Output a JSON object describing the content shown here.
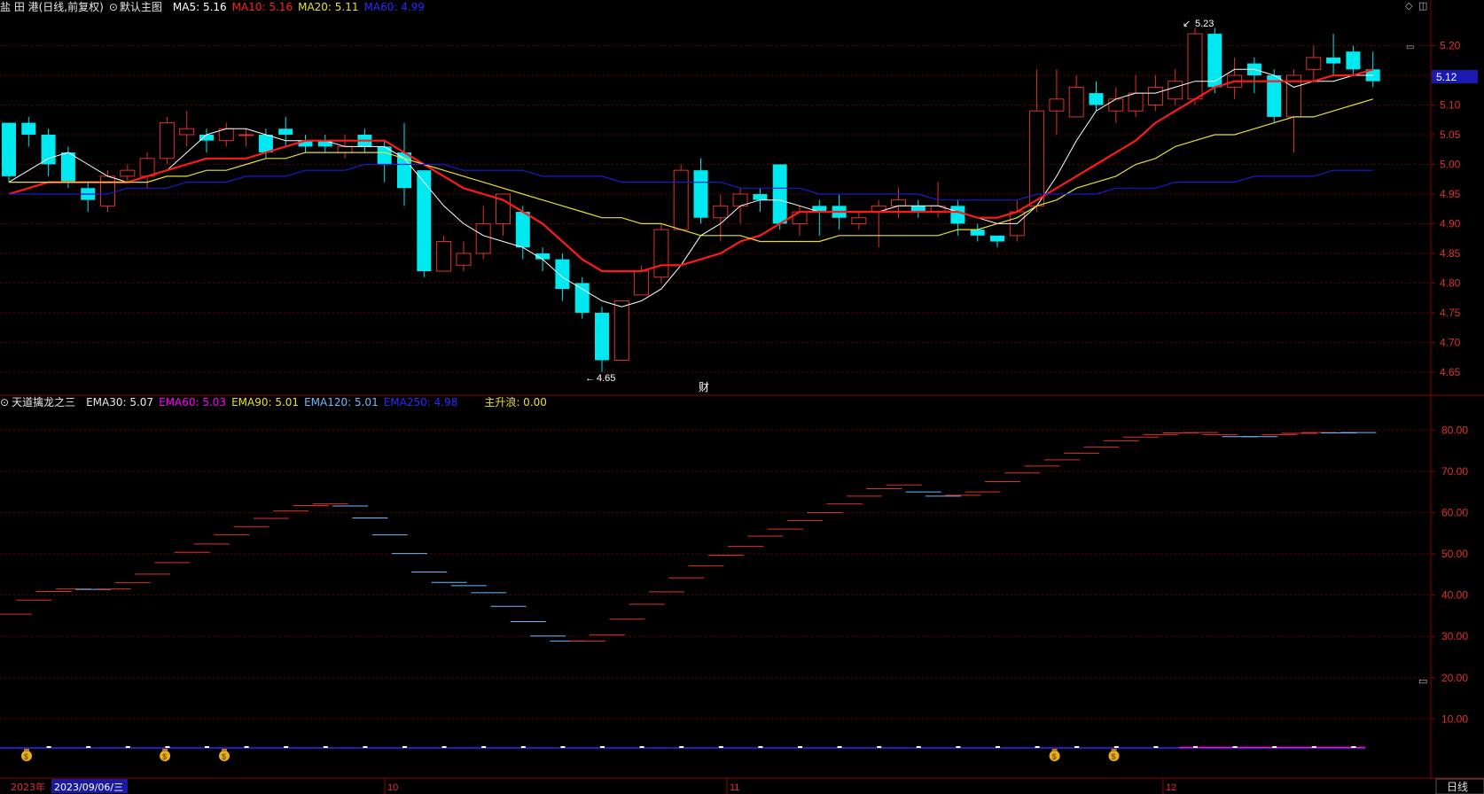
{
  "header": {
    "stock_title": "盐 田 港(日线,前复权)",
    "main_chart_label": "默认主图",
    "ma5": "MA5: 5.16",
    "ma10": "MA10: 5.16",
    "ma20": "MA20: 5.11",
    "ma60": "MA60: 4.99"
  },
  "indicator_header": {
    "name": "天道擒龙之三",
    "ema30": "EMA30: 5.07",
    "ema60": "EMA60: 5.03",
    "ema90": "EMA90: 5.01",
    "ema120": "EMA120: 5.01",
    "ema250": "EMA250: 4.98",
    "main_wave": "主升浪: 0.00"
  },
  "footer": {
    "year_label": "2023年",
    "date_label": "2023/09/06/三",
    "month_labels": [
      "10",
      "11",
      "12"
    ],
    "period_button": "日线"
  },
  "annotations": {
    "high_label": "5.23",
    "low_label": "4.65",
    "fin_marker": "财",
    "current_price": "5.12"
  },
  "colors": {
    "up": "#e0302a",
    "down": "#00e8f0",
    "ma5": "#ffffff",
    "ma10": "#ff1a1a",
    "ma20": "#e8e030",
    "ma60": "#1a1ad0",
    "ema60": "#ff00ff",
    "ema90": "#e8e030",
    "ema120": "#6fb9ff",
    "ema250": "#1a1ad0",
    "grid": "#6a0000",
    "axis_text": "#e03030"
  },
  "chart_data": [
    {
      "type": "candlestick",
      "title": "",
      "ylim": [
        4.62,
        5.25
      ],
      "y_ticks": [
        4.65,
        4.7,
        4.75,
        4.8,
        4.85,
        4.9,
        4.95,
        5.0,
        5.05,
        5.1,
        5.15,
        5.2
      ],
      "candles": [
        [
          5.07,
          4.98,
          5.07,
          4.97
        ],
        [
          5.07,
          5.05,
          5.08,
          5.03
        ],
        [
          5.05,
          5.0,
          5.06,
          4.98
        ],
        [
          5.02,
          4.97,
          5.03,
          4.96
        ],
        [
          4.96,
          4.94,
          4.97,
          4.92
        ],
        [
          4.93,
          4.98,
          4.99,
          4.92
        ],
        [
          4.98,
          4.99,
          5.0,
          4.97
        ],
        [
          4.98,
          5.01,
          5.02,
          4.96
        ],
        [
          5.01,
          5.07,
          5.08,
          5.0
        ],
        [
          5.05,
          5.06,
          5.09,
          5.03
        ],
        [
          5.05,
          5.04,
          5.06,
          5.02
        ],
        [
          5.04,
          5.06,
          5.07,
          5.03
        ],
        [
          5.05,
          5.05,
          5.06,
          5.03
        ],
        [
          5.05,
          5.02,
          5.06,
          5.01
        ],
        [
          5.06,
          5.05,
          5.08,
          5.03
        ],
        [
          5.04,
          5.03,
          5.05,
          5.02
        ],
        [
          5.04,
          5.03,
          5.05,
          5.02
        ],
        [
          5.02,
          5.03,
          5.05,
          5.01
        ],
        [
          5.05,
          5.03,
          5.06,
          5.02
        ],
        [
          5.03,
          5.0,
          5.04,
          4.97
        ],
        [
          5.02,
          4.96,
          5.07,
          4.93
        ],
        [
          4.99,
          4.82,
          4.99,
          4.81
        ],
        [
          4.82,
          4.87,
          4.88,
          4.82
        ],
        [
          4.83,
          4.85,
          4.87,
          4.82
        ],
        [
          4.85,
          4.9,
          4.93,
          4.84
        ],
        [
          4.9,
          4.95,
          4.95,
          4.88
        ],
        [
          4.92,
          4.86,
          4.93,
          4.84
        ],
        [
          4.85,
          4.84,
          4.86,
          4.82
        ],
        [
          4.84,
          4.79,
          4.85,
          4.77
        ],
        [
          4.8,
          4.75,
          4.81,
          4.74
        ],
        [
          4.75,
          4.67,
          4.76,
          4.65
        ],
        [
          4.67,
          4.77,
          4.77,
          4.67
        ],
        [
          4.78,
          4.82,
          4.83,
          4.78
        ],
        [
          4.81,
          4.89,
          4.9,
          4.8
        ],
        [
          4.89,
          4.99,
          5.0,
          4.89
        ],
        [
          4.99,
          4.91,
          5.01,
          4.9
        ],
        [
          4.91,
          4.93,
          4.95,
          4.87
        ],
        [
          4.93,
          4.95,
          4.96,
          4.9
        ],
        [
          4.95,
          4.94,
          4.96,
          4.92
        ],
        [
          5.0,
          4.9,
          5.0,
          4.89
        ],
        [
          4.9,
          4.92,
          4.93,
          4.88
        ],
        [
          4.93,
          4.92,
          4.94,
          4.88
        ],
        [
          4.93,
          4.91,
          4.95,
          4.89
        ],
        [
          4.9,
          4.91,
          4.92,
          4.89
        ],
        [
          4.92,
          4.93,
          4.94,
          4.86
        ],
        [
          4.93,
          4.94,
          4.96,
          4.91
        ],
        [
          4.93,
          4.92,
          4.94,
          4.91
        ],
        [
          4.92,
          4.93,
          4.97,
          4.91
        ],
        [
          4.93,
          4.9,
          4.94,
          4.88
        ],
        [
          4.89,
          4.88,
          4.9,
          4.87
        ],
        [
          4.88,
          4.87,
          4.88,
          4.86
        ],
        [
          4.88,
          4.92,
          4.94,
          4.87
        ],
        [
          4.93,
          5.09,
          5.16,
          4.92
        ],
        [
          5.09,
          5.11,
          5.16,
          5.05
        ],
        [
          5.08,
          5.13,
          5.15,
          5.08
        ],
        [
          5.12,
          5.1,
          5.14,
          5.09
        ],
        [
          5.09,
          5.11,
          5.13,
          5.07
        ],
        [
          5.09,
          5.12,
          5.15,
          5.08
        ],
        [
          5.1,
          5.13,
          5.15,
          5.09
        ],
        [
          5.11,
          5.14,
          5.16,
          5.1
        ],
        [
          5.11,
          5.22,
          5.23,
          5.1
        ],
        [
          5.22,
          5.13,
          5.23,
          5.12
        ],
        [
          5.13,
          5.15,
          5.18,
          5.11
        ],
        [
          5.17,
          5.15,
          5.18,
          5.12
        ],
        [
          5.15,
          5.08,
          5.16,
          5.07
        ],
        [
          5.08,
          5.15,
          5.16,
          5.02
        ],
        [
          5.16,
          5.18,
          5.2,
          5.14
        ],
        [
          5.18,
          5.17,
          5.22,
          5.15
        ],
        [
          5.19,
          5.16,
          5.2,
          5.15
        ],
        [
          5.16,
          5.14,
          5.19,
          5.13
        ]
      ],
      "ma_series": [
        {
          "name": "MA5",
          "values": [
            4.97,
            4.99,
            5.01,
            5.02,
            5.0,
            4.98,
            4.97,
            4.98,
            4.99,
            5.02,
            5.05,
            5.06,
            5.06,
            5.05,
            5.04,
            5.04,
            5.04,
            5.03,
            5.03,
            5.03,
            5.01,
            4.97,
            4.93,
            4.9,
            4.88,
            4.87,
            4.86,
            4.84,
            4.81,
            4.79,
            4.77,
            4.76,
            4.77,
            4.79,
            4.83,
            4.88,
            4.9,
            4.93,
            4.94,
            4.94,
            4.93,
            4.92,
            4.92,
            4.92,
            4.92,
            4.93,
            4.93,
            4.93,
            4.92,
            4.91,
            4.9,
            4.9,
            4.93,
            4.98,
            5.04,
            5.09,
            5.11,
            5.12,
            5.12,
            5.13,
            5.14,
            5.14,
            5.16,
            5.16,
            5.15,
            5.13,
            5.14,
            5.14,
            5.15,
            5.15
          ]
        },
        {
          "name": "MA10",
          "values": [
            4.95,
            4.96,
            4.97,
            4.97,
            4.97,
            4.97,
            4.97,
            4.98,
            4.99,
            5.0,
            5.01,
            5.01,
            5.01,
            5.02,
            5.03,
            5.04,
            5.04,
            5.04,
            5.04,
            5.04,
            5.02,
            5.0,
            4.98,
            4.96,
            4.95,
            4.94,
            4.92,
            4.9,
            4.87,
            4.84,
            4.82,
            4.82,
            4.82,
            4.83,
            4.83,
            4.84,
            4.85,
            4.87,
            4.88,
            4.9,
            4.92,
            4.92,
            4.92,
            4.92,
            4.92,
            4.92,
            4.92,
            4.92,
            4.92,
            4.91,
            4.91,
            4.92,
            4.94,
            4.96,
            4.98,
            5.0,
            5.02,
            5.04,
            5.07,
            5.09,
            5.11,
            5.13,
            5.14,
            5.14,
            5.14,
            5.14,
            5.14,
            5.15,
            5.15,
            5.16
          ]
        },
        {
          "name": "MA20",
          "values": [
            4.97,
            4.97,
            4.97,
            4.97,
            4.97,
            4.97,
            4.97,
            4.97,
            4.98,
            4.98,
            4.99,
            4.99,
            5.0,
            5.01,
            5.01,
            5.02,
            5.02,
            5.02,
            5.02,
            5.02,
            5.01,
            5.0,
            4.99,
            4.98,
            4.97,
            4.96,
            4.95,
            4.94,
            4.93,
            4.92,
            4.91,
            4.91,
            4.9,
            4.9,
            4.89,
            4.88,
            4.88,
            4.88,
            4.87,
            4.87,
            4.87,
            4.87,
            4.88,
            4.88,
            4.88,
            4.88,
            4.88,
            4.88,
            4.89,
            4.89,
            4.9,
            4.91,
            4.93,
            4.94,
            4.96,
            4.97,
            4.98,
            5.0,
            5.01,
            5.03,
            5.04,
            5.05,
            5.05,
            5.06,
            5.07,
            5.08,
            5.08,
            5.09,
            5.1,
            5.11
          ]
        },
        {
          "name": "MA60",
          "values": [
            4.95,
            4.95,
            4.95,
            4.95,
            4.95,
            4.95,
            4.96,
            4.96,
            4.96,
            4.97,
            4.97,
            4.97,
            4.98,
            4.98,
            4.98,
            4.99,
            4.99,
            4.99,
            5.0,
            5.0,
            5.0,
            5.0,
            5.0,
            4.99,
            4.99,
            4.99,
            4.99,
            4.98,
            4.98,
            4.98,
            4.98,
            4.97,
            4.97,
            4.97,
            4.97,
            4.97,
            4.97,
            4.96,
            4.96,
            4.96,
            4.96,
            4.95,
            4.95,
            4.95,
            4.95,
            4.95,
            4.95,
            4.94,
            4.94,
            4.94,
            4.94,
            4.94,
            4.95,
            4.95,
            4.95,
            4.95,
            4.96,
            4.96,
            4.96,
            4.97,
            4.97,
            4.97,
            4.97,
            4.98,
            4.98,
            4.98,
            4.98,
            4.99,
            4.99,
            4.99
          ]
        }
      ]
    },
    {
      "type": "indicator",
      "title": "",
      "ylim": [
        0,
        85
      ],
      "y_ticks": [
        10,
        20,
        30,
        40,
        50,
        60,
        70,
        80
      ],
      "steps": [
        [
          35.4,
          "up"
        ],
        [
          38.8,
          "up"
        ],
        [
          40.9,
          "up"
        ],
        [
          41.5,
          "up"
        ],
        [
          41.4,
          "down"
        ],
        [
          41.5,
          "up"
        ],
        [
          43.0,
          "up"
        ],
        [
          45.1,
          "up"
        ],
        [
          47.9,
          "up"
        ],
        [
          50.4,
          "up"
        ],
        [
          52.4,
          "up"
        ],
        [
          54.6,
          "up"
        ],
        [
          56.6,
          "up"
        ],
        [
          58.6,
          "up"
        ],
        [
          60.4,
          "up"
        ],
        [
          61.7,
          "up"
        ],
        [
          62.1,
          "up"
        ],
        [
          61.6,
          "down"
        ],
        [
          58.7,
          "down"
        ],
        [
          54.6,
          "down"
        ],
        [
          50.1,
          "down"
        ],
        [
          45.6,
          "down"
        ],
        [
          43.1,
          "down"
        ],
        [
          42.3,
          "down"
        ],
        [
          40.6,
          "down"
        ],
        [
          37.3,
          "down"
        ],
        [
          33.6,
          "down"
        ],
        [
          30.1,
          "down"
        ],
        [
          28.9,
          "down"
        ],
        [
          28.9,
          "up"
        ],
        [
          30.4,
          "up"
        ],
        [
          34.2,
          "up"
        ],
        [
          37.8,
          "up"
        ],
        [
          40.8,
          "up"
        ],
        [
          44.2,
          "up"
        ],
        [
          47.1,
          "up"
        ],
        [
          49.7,
          "up"
        ],
        [
          51.8,
          "up"
        ],
        [
          54.3,
          "up"
        ],
        [
          56.0,
          "up"
        ],
        [
          58.1,
          "up"
        ],
        [
          60.0,
          "up"
        ],
        [
          62.1,
          "up"
        ],
        [
          64.0,
          "up"
        ],
        [
          65.8,
          "up"
        ],
        [
          66.7,
          "up"
        ],
        [
          65.0,
          "down"
        ],
        [
          64.0,
          "down"
        ],
        [
          64.2,
          "up"
        ],
        [
          65.0,
          "up"
        ],
        [
          67.5,
          "up"
        ],
        [
          69.6,
          "up"
        ],
        [
          71.3,
          "up"
        ],
        [
          72.8,
          "up"
        ],
        [
          74.4,
          "up"
        ],
        [
          75.9,
          "up"
        ],
        [
          77.4,
          "up"
        ],
        [
          78.3,
          "up"
        ],
        [
          78.9,
          "up"
        ],
        [
          79.3,
          "up"
        ],
        [
          79.4,
          "up"
        ],
        [
          78.9,
          "up"
        ],
        [
          78.4,
          "down"
        ],
        [
          78.4,
          "down"
        ],
        [
          78.9,
          "up"
        ],
        [
          79.2,
          "up"
        ],
        [
          79.4,
          "up"
        ],
        [
          79.3,
          "down"
        ],
        [
          79.4,
          "down"
        ]
      ],
      "signal_markers": [
        0,
        7,
        10,
        52,
        55
      ]
    }
  ]
}
